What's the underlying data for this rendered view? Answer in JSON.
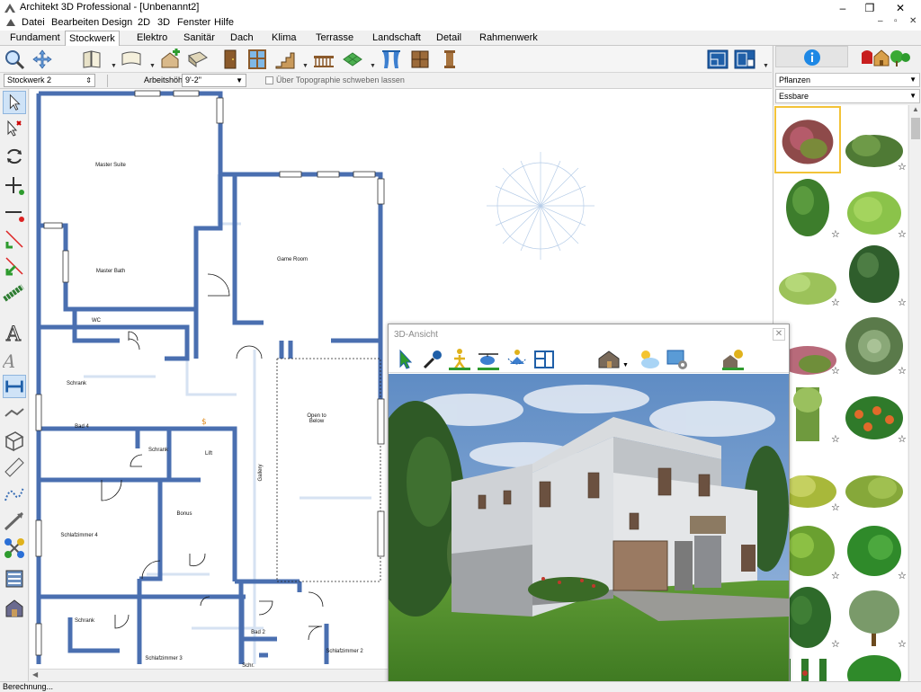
{
  "window": {
    "title": "Architekt 3D Professional - [Unbenannt2]",
    "minimize": "–",
    "maximize": "❐",
    "close": "✕",
    "mdi_minimize": "–",
    "mdi_restore": "▫",
    "mdi_close": "✕"
  },
  "menu": [
    "Datei",
    "Bearbeiten",
    "Design",
    "2D",
    "3D",
    "Fenster",
    "Hilfe"
  ],
  "tabs": [
    "Fundament",
    "Stockwerk",
    "Elektro",
    "Sanitär",
    "Dach",
    "Klima",
    "Terrasse",
    "Landschaft",
    "Detail",
    "Rahmenwerk"
  ],
  "active_tab": "Stockwerk",
  "options": {
    "floor_select": "Stockwerk 2",
    "height_label": "Arbeitshöhe",
    "height_value": "9'-2\"",
    "topography_label": "Über Topographie schweben lassen"
  },
  "rooms": [
    "Master Suite",
    "Master Bath",
    "WC",
    "Game Room",
    "Open to Below",
    "Schrank",
    "Bad 4",
    "Schrank",
    "Lift",
    "Gallery",
    "Schlafzimmer 4",
    "Bonus",
    "Schrank",
    "Bad 2",
    "Schlafzimmer 3",
    "Schlafzimmer 2",
    "Schr."
  ],
  "right_panel": {
    "category": "Pflanzen",
    "subcategory": "Essbare"
  },
  "view3d": {
    "title": "3D-Ansicht",
    "close": "✕"
  },
  "status": "Berechnung...",
  "colors": {
    "wall": "#4a6fb0",
    "wall_light": "#8faedb",
    "sky": "#6d94c7",
    "grass": "#4f8a2c",
    "selection": "#f3c338"
  }
}
